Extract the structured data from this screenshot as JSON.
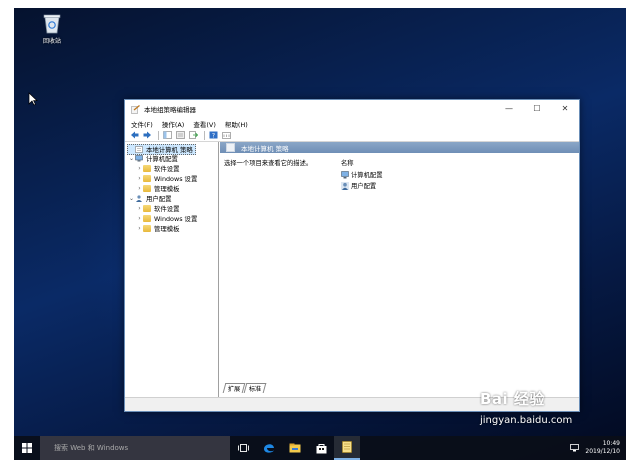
{
  "desktop": {
    "recycle_bin_label": "回收站"
  },
  "window": {
    "title": "本地组策略编辑器",
    "controls": {
      "minimize": "—",
      "maximize": "☐",
      "close": "✕"
    },
    "menu": [
      "文件(F)",
      "操作(A)",
      "查看(V)",
      "帮助(H)"
    ],
    "tree": {
      "root": "本地计算机 策略",
      "computer_config": "计算机配置",
      "user_config": "用户配置",
      "software_settings": "软件设置",
      "windows_settings": "Windows 设置",
      "admin_templates": "管理模板"
    },
    "right": {
      "header": "本地计算机 策略",
      "description": "选择一个项目来查看它的描述。",
      "column_name": "名称",
      "items": [
        "计算机配置",
        "用户配置"
      ]
    },
    "tabs": [
      "扩展",
      "标准"
    ]
  },
  "taskbar": {
    "search_placeholder": "搜索 Web 和 Windows",
    "time": "10:49",
    "date": "2019/12/10"
  },
  "watermark": {
    "brand": "Bai 经验",
    "url": "jingyan.baidu.com"
  },
  "colors": {
    "header_blue": "#7a97bd",
    "selection": "#cde8ff",
    "edge_blue": "#1e88e5"
  }
}
